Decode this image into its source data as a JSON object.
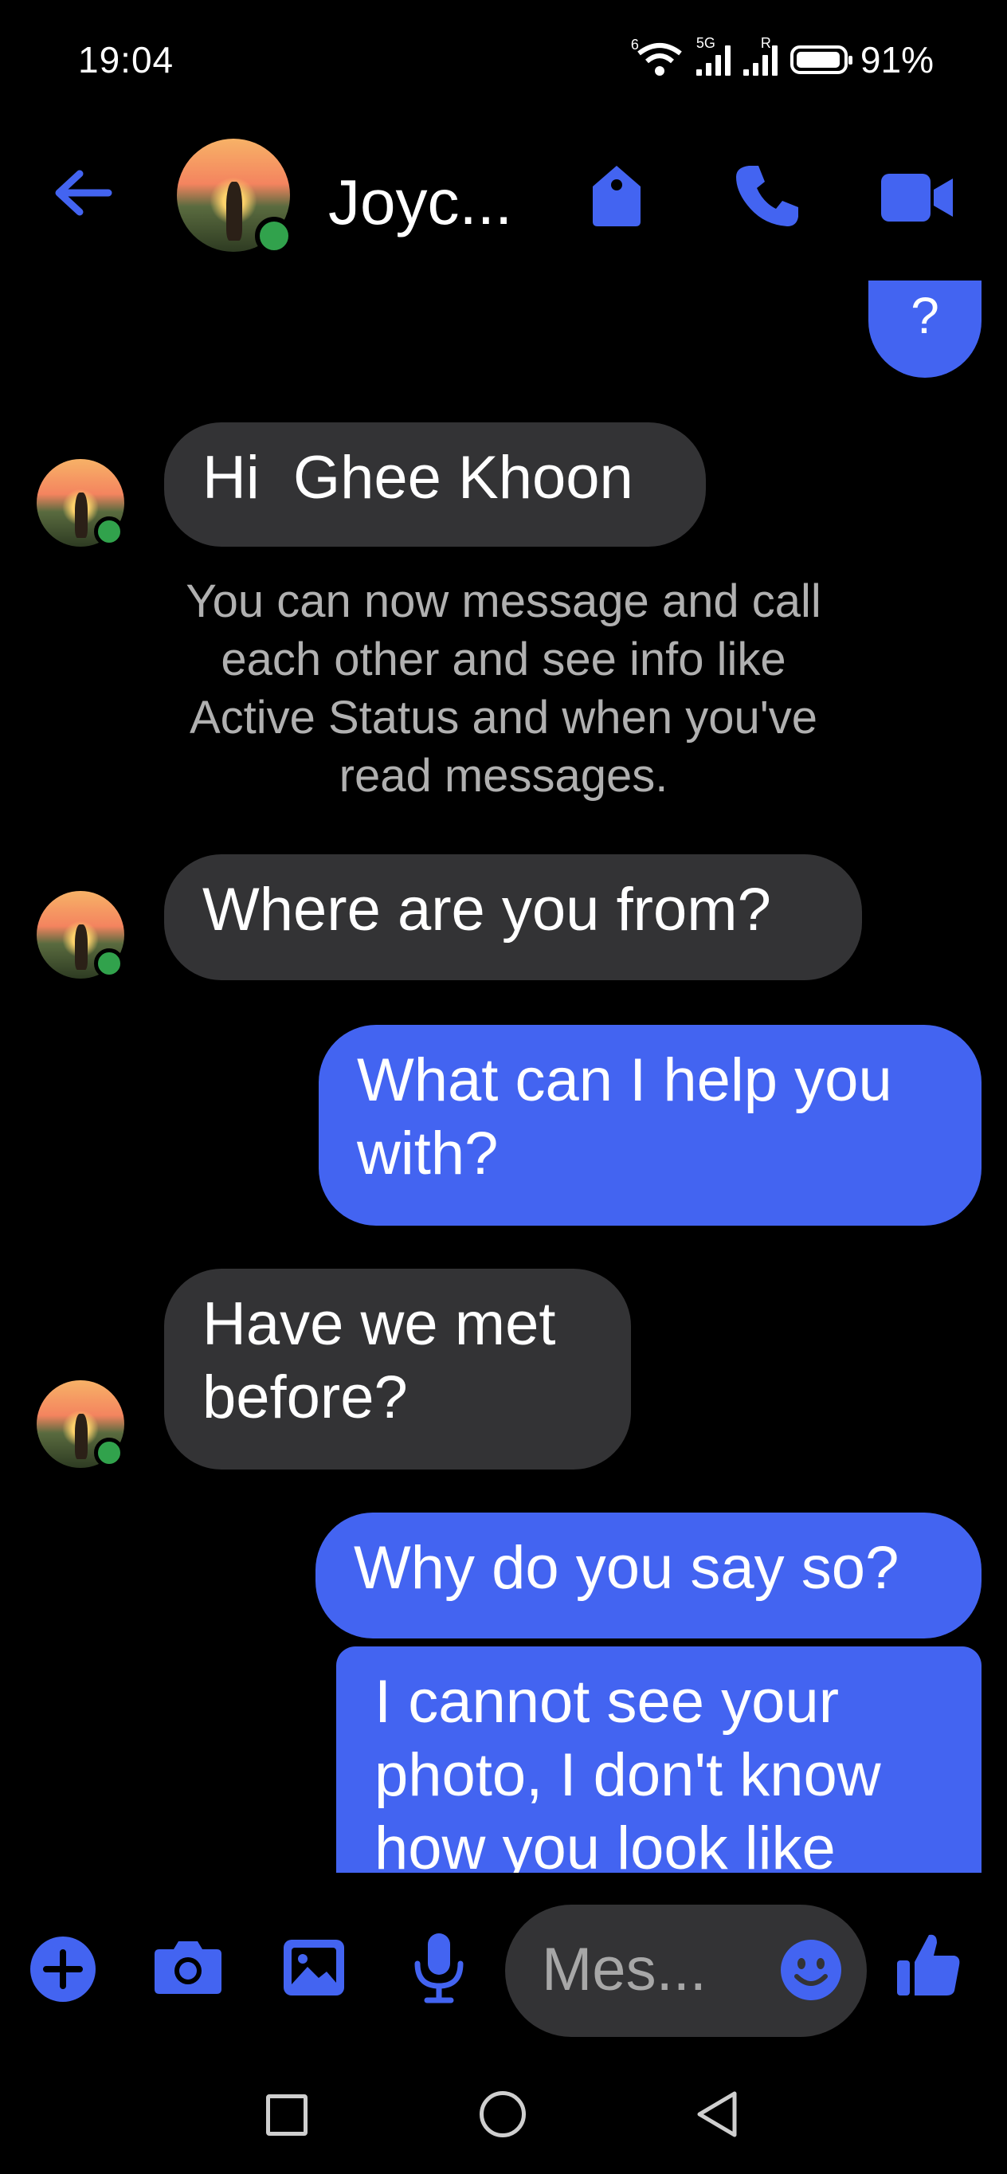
{
  "status_bar": {
    "time": "19:04",
    "wifi_superscript": "6",
    "network_type": "5G",
    "roaming_indicator": "R",
    "battery": "91%"
  },
  "header": {
    "contact_name": "Joyc...",
    "icons": [
      "back-arrow-icon",
      "tag-icon",
      "phone-icon",
      "video-camera-icon"
    ],
    "accent_color": "#4364f1"
  },
  "messages": [
    {
      "side": "outgoing",
      "text": "?"
    },
    {
      "side": "incoming",
      "text": "Hi  Ghee Khoon"
    },
    {
      "side": "system",
      "text": "You can now message and call each other and see info like Active Status and when you've read messages."
    },
    {
      "side": "incoming",
      "text": "Where are you from?"
    },
    {
      "side": "outgoing",
      "text": "What can I help you with?"
    },
    {
      "side": "incoming",
      "text": "Have we met before?"
    },
    {
      "side": "outgoing",
      "text": "Why do you say so?"
    },
    {
      "side": "outgoing",
      "text": "I cannot see your photo, I don't know how you look like"
    }
  ],
  "composer": {
    "placeholder": "Mes...",
    "icons": [
      "plus-icon",
      "camera-icon",
      "gallery-icon",
      "microphone-icon",
      "emoji-icon",
      "thumbs-up-icon"
    ]
  },
  "colors": {
    "background": "#000000",
    "incoming_bubble": "#333335",
    "outgoing_bubble": "#4364f1",
    "online": "#31a24c"
  }
}
